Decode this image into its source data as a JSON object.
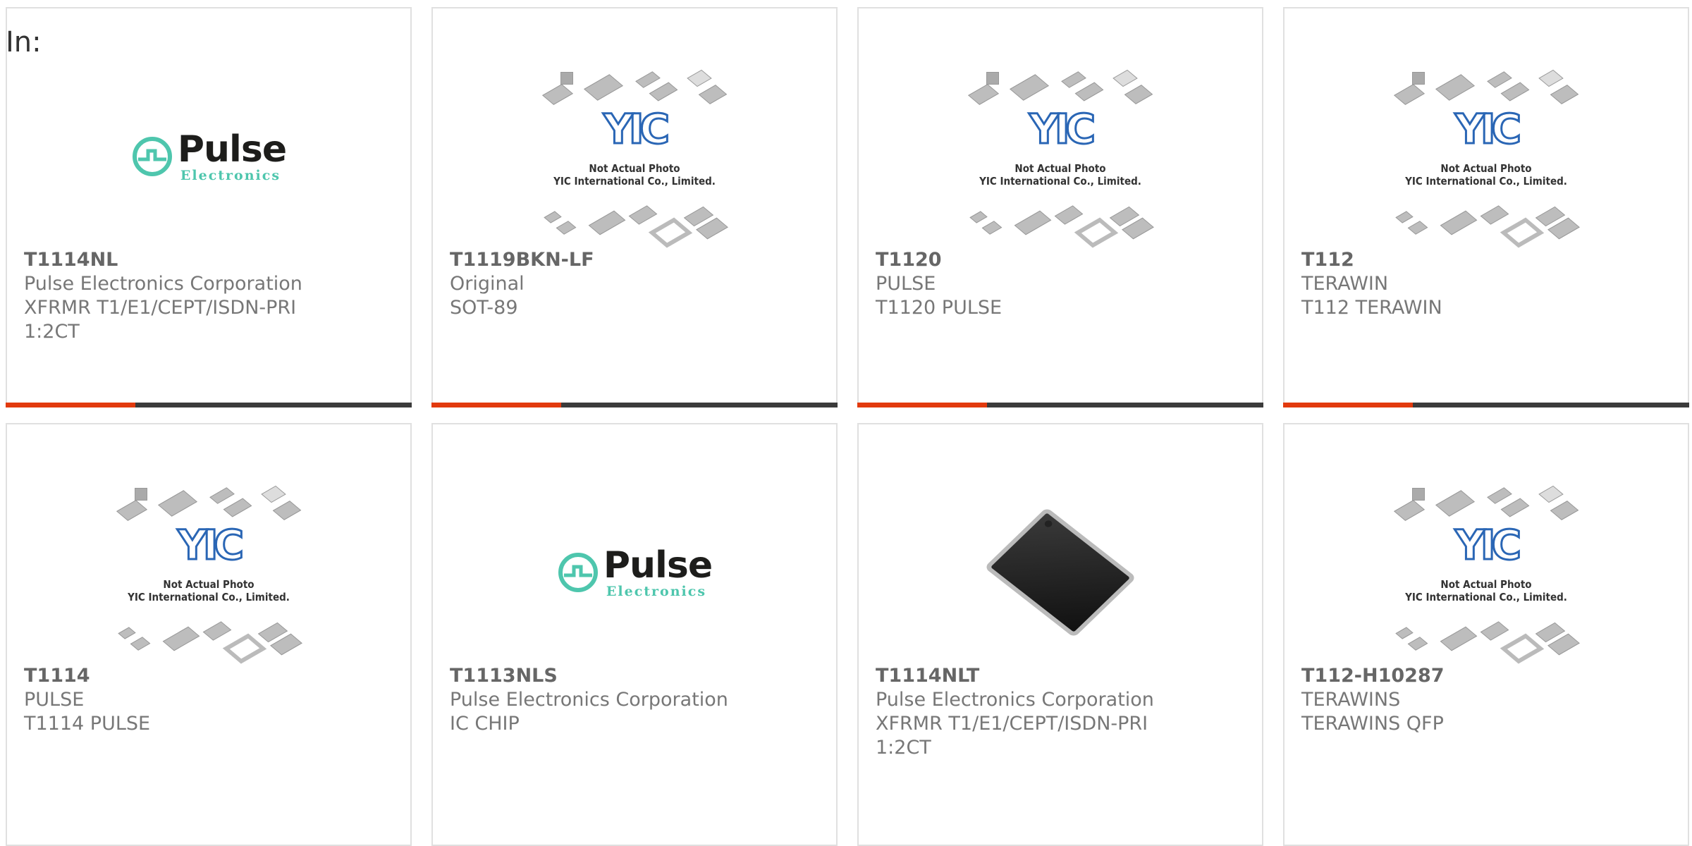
{
  "filter_label": "In:",
  "products": [
    {
      "part": "T1114NL",
      "line1": "Pulse Electronics Corporation",
      "line2": "XFRMR T1/E1/CEPT/ISDN-PRI",
      "line3": "1:2CT",
      "image": "pulse-logo"
    },
    {
      "part": "T1119BKN-LF",
      "line1": "Original",
      "line2": "SOT-89",
      "line3": "",
      "image": "yic-placeholder"
    },
    {
      "part": "T1120",
      "line1": "PULSE",
      "line2": "T1120 PULSE",
      "line3": "",
      "image": "yic-placeholder"
    },
    {
      "part": "T112",
      "line1": "TERAWIN",
      "line2": "T112 TERAWIN",
      "line3": "",
      "image": "yic-placeholder"
    },
    {
      "part": "T1114",
      "line1": "PULSE",
      "line2": "T1114 PULSE",
      "line3": "",
      "image": "yic-placeholder"
    },
    {
      "part": "T1113NLS",
      "line1": "Pulse Electronics Corporation",
      "line2": "IC CHIP",
      "line3": "",
      "image": "pulse-logo"
    },
    {
      "part": "T1114NLT",
      "line1": "Pulse Electronics Corporation",
      "line2": "XFRMR T1/E1/CEPT/ISDN-PRI",
      "line3": "1:2CT",
      "image": "ic-chip-photo"
    },
    {
      "part": "T112-H10287",
      "line1": "TERAWINS",
      "line2": "TERAWINS QFP",
      "line3": "",
      "image": "yic-placeholder"
    }
  ],
  "images": {
    "pulse_logo": {
      "word": "Pulse",
      "sub": "Electronics",
      "brand_color": "#4ec6ad"
    },
    "yic_placeholder": {
      "mark": "YIC",
      "caption_line1": "Not Actual Photo",
      "caption_line2": "YIC International Co., Limited.",
      "brand_color": "#2a66b5"
    }
  },
  "colors": {
    "accent": "#e23a0e",
    "bar": "#3b3b3b",
    "border": "#e0e0e0"
  }
}
